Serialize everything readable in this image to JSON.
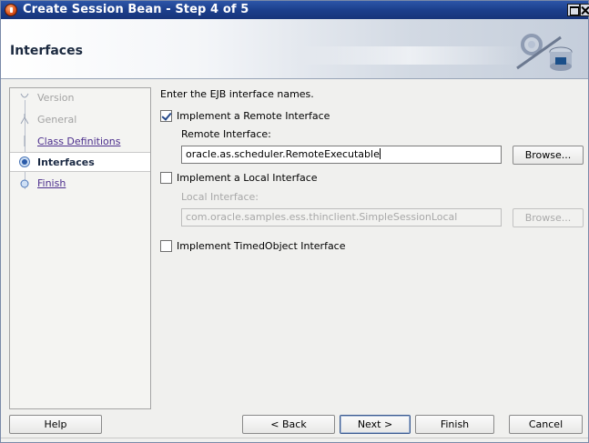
{
  "window": {
    "title": "Create Session Bean - Step 4 of 5"
  },
  "header": {
    "title": "Interfaces"
  },
  "steps": [
    {
      "label": "Version",
      "state": "disabled"
    },
    {
      "label": "General",
      "state": "disabled"
    },
    {
      "label": "Class Definitions",
      "state": "link"
    },
    {
      "label": "Interfaces",
      "state": "current"
    },
    {
      "label": "Finish",
      "state": "link"
    }
  ],
  "main": {
    "instruction": "Enter the EJB interface names.",
    "remote": {
      "checkbox_label": "Implement a Remote Interface",
      "checked": true,
      "field_label": "Remote Interface:",
      "value": "oracle.as.scheduler.RemoteExecutable",
      "browse_label": "Browse..."
    },
    "local": {
      "checkbox_label": "Implement a Local Interface",
      "checked": false,
      "field_label": "Local Interface:",
      "value": "com.oracle.samples.ess.thinclient.SimpleSessionLocal",
      "browse_label": "Browse..."
    },
    "timed": {
      "checkbox_label": "Implement TimedObject Interface",
      "checked": false
    }
  },
  "footer": {
    "help_label": "Help",
    "back_label": "< Back",
    "next_label": "Next >",
    "finish_label": "Finish",
    "cancel_label": "Cancel"
  },
  "colors": {
    "title_bar": "#1c3f8c",
    "link": "#4b2d8c",
    "accent": "#274a8a"
  }
}
